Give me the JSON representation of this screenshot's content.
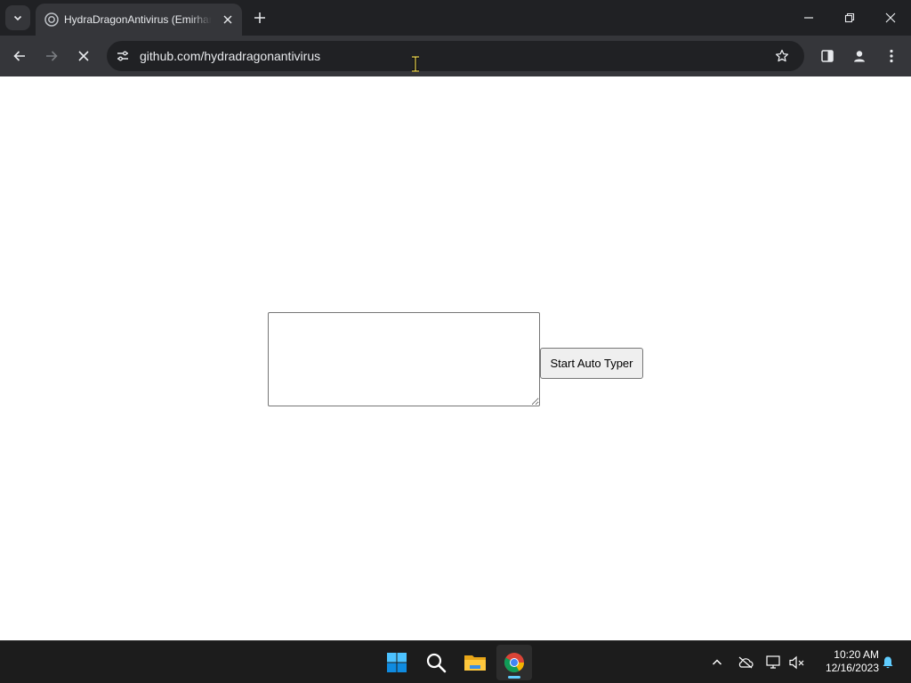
{
  "browser": {
    "tab": {
      "title": "HydraDragonAntivirus (Emirhan Ucan)",
      "icon": "github-icon"
    },
    "address_bar": {
      "url": "github.com/hydradragonantivirus"
    },
    "loading": true
  },
  "page": {
    "textarea": {
      "value": "",
      "placeholder": ""
    },
    "start_button_label": "Start Auto Typer"
  },
  "taskbar": {
    "apps": [
      "start-icon",
      "search-icon",
      "file-explorer-icon",
      "chrome-icon"
    ],
    "active_app": "chrome-icon",
    "clock": {
      "time": "10:20 AM",
      "date": "12/16/2023"
    }
  },
  "colors": {
    "tabstrip_bg": "#202124",
    "toolbar_bg": "#35363a",
    "taskbar_bg": "#1c1c1c",
    "accent": "#60cdff"
  }
}
